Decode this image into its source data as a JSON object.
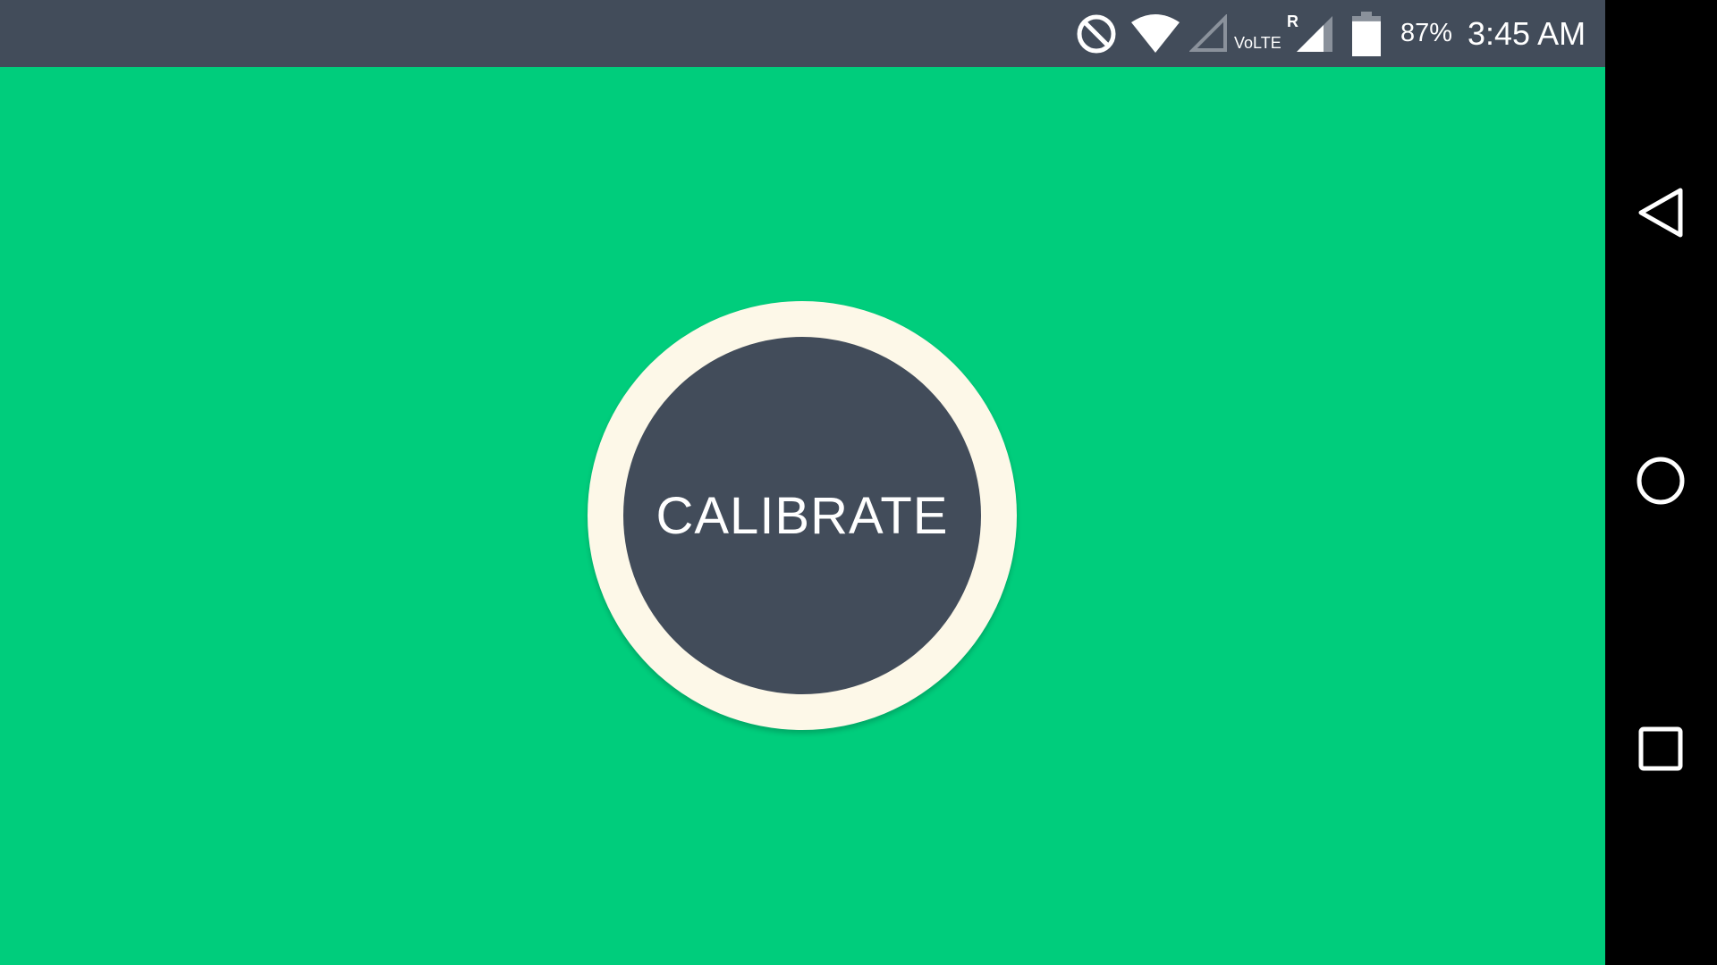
{
  "status_bar": {
    "icons": [
      "do-not-disturb-icon",
      "wifi-icon",
      "signal-empty-icon",
      "signal-roaming-icon",
      "battery-icon"
    ],
    "volte_label": "VoLTE",
    "roaming_label": "R",
    "battery_percent": "87%",
    "battery_level": 0.87,
    "time": "3:45 AM"
  },
  "main": {
    "calibrate_label": "CALIBRATE"
  },
  "nav_bar": {
    "icons": [
      "back-icon",
      "home-icon",
      "recents-icon"
    ]
  },
  "colors": {
    "background": "#00cd7c",
    "status_bar": "#424c5a",
    "button_ring": "#fdf8e8",
    "button_fill": "#424c5a",
    "nav_bar": "#000000"
  }
}
